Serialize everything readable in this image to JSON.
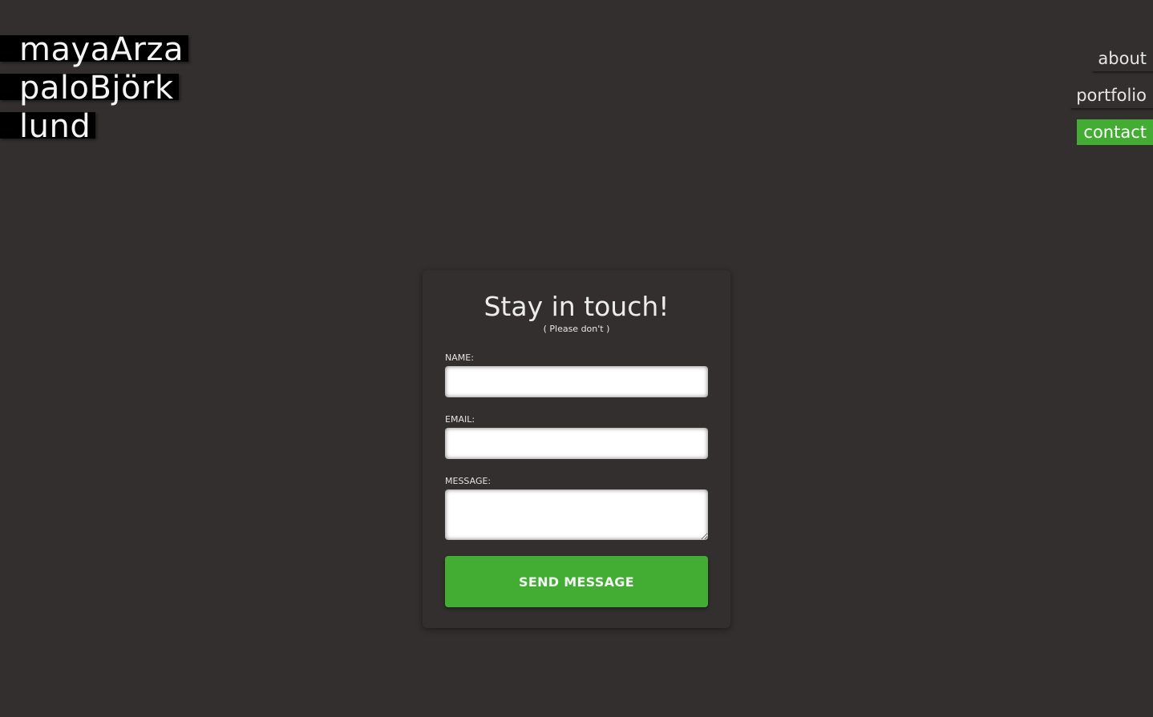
{
  "logo": {
    "lines": [
      "mayaArza",
      "paloBjörk",
      "lund"
    ]
  },
  "theme_toggle": {
    "icon": "moon-icon"
  },
  "nav": {
    "items": [
      {
        "label": "about",
        "active": false
      },
      {
        "label": "portfolio",
        "active": false
      },
      {
        "label": "contact",
        "active": true
      }
    ]
  },
  "contact_form": {
    "title": "Stay in touch!",
    "subtitle": "( Please don't )",
    "fields": {
      "name": {
        "label": "NAME:",
        "value": "",
        "placeholder": ""
      },
      "email": {
        "label": "EMAIL:",
        "value": "",
        "placeholder": ""
      },
      "message": {
        "label": "MESSAGE:",
        "value": "",
        "placeholder": ""
      }
    },
    "submit_label": "SEND MESSAGE"
  },
  "colors": {
    "background": "#332f2f",
    "accent": "#43ad33",
    "logo_bg": "#000000"
  }
}
